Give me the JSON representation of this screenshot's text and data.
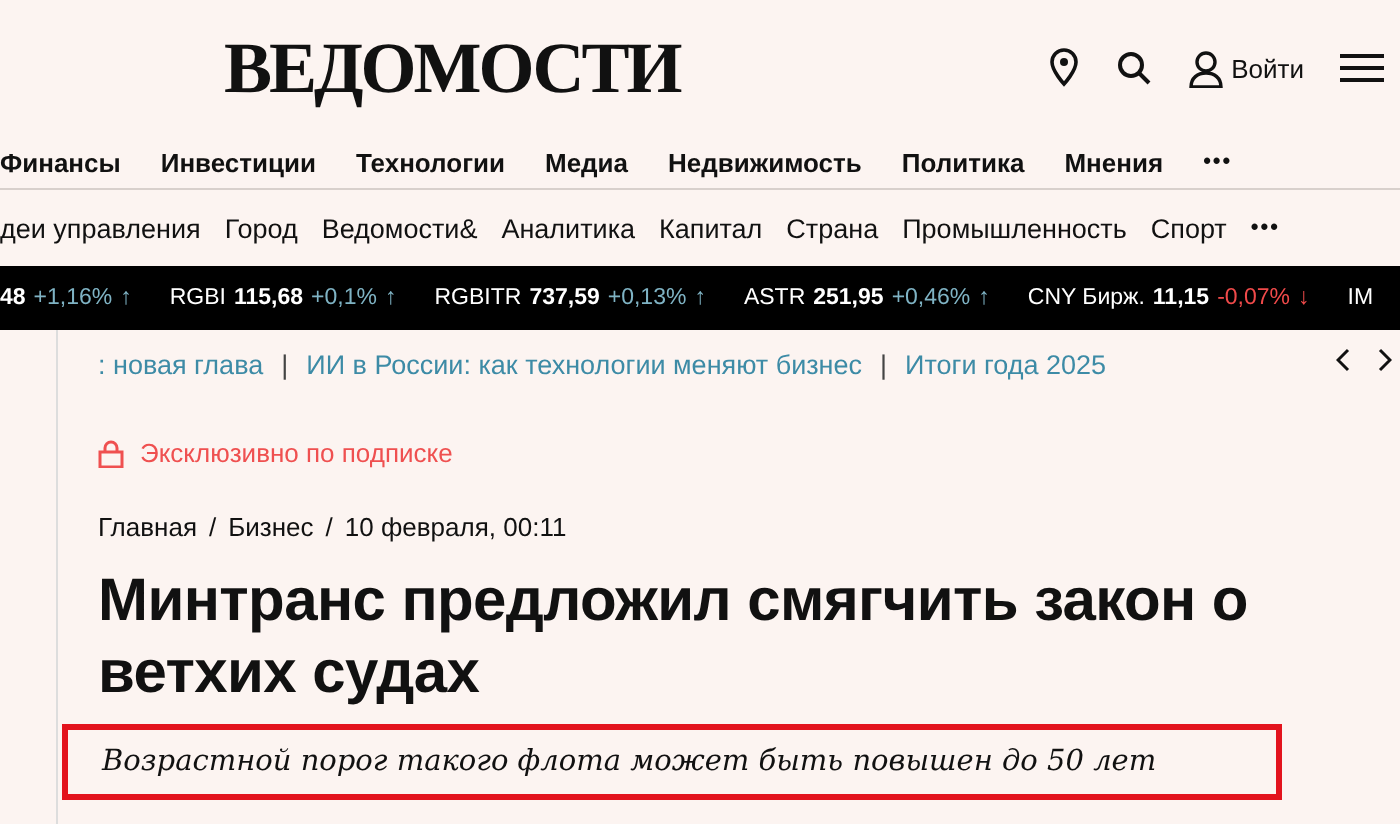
{
  "header": {
    "logo": "ВЕДОМОСТИ",
    "login": "Войти"
  },
  "main_nav": {
    "items": [
      "Финансы",
      "Инвестиции",
      "Технологии",
      "Медиа",
      "Недвижимость",
      "Политика",
      "Мнения"
    ],
    "more": "•••"
  },
  "sub_nav": {
    "items": [
      "деи управления",
      "Город",
      "Ведомости&",
      "Аналитика",
      "Капитал",
      "Страна",
      "Промышленность",
      "Спорт"
    ],
    "more": "•••"
  },
  "ticker": [
    {
      "value": "48",
      "change": "+1,16%",
      "arrow": "↑",
      "negative": false
    },
    {
      "label": "RGBI",
      "value": "115,68",
      "change": "+0,1%",
      "arrow": "↑",
      "negative": false
    },
    {
      "label": "RGBITR",
      "value": "737,59",
      "change": "+0,13%",
      "arrow": "↑",
      "negative": false
    },
    {
      "label": "ASTR",
      "value": "251,95",
      "change": "+0,46%",
      "arrow": "↑",
      "negative": false
    },
    {
      "label": "CNY Бирж.",
      "value": "11,15",
      "change": "-0,07%",
      "arrow": "↓",
      "negative": true
    },
    {
      "label": "IM"
    }
  ],
  "topics": {
    "separator": "|",
    "items": [
      ": новая глава",
      "ИИ в России: как технологии меняют бизнес",
      "Итоги года 2025"
    ]
  },
  "article": {
    "badge": "Эксклюзивно по подписке",
    "breadcrumb_separator": "/",
    "breadcrumbs": [
      "Главная",
      "Бизнес",
      "10 февраля, 00:11"
    ],
    "title": "Минтранс предложил смягчить закон о ветхих судах",
    "subtitle": "Возрастной порог такого флота может быть повышен до 50 лет",
    "subtitle_highlighted": true
  }
}
